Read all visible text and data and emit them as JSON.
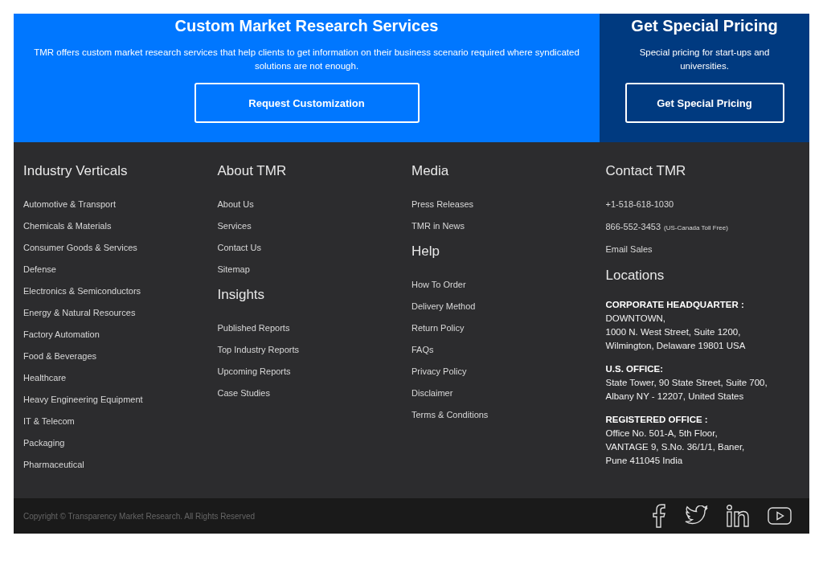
{
  "hero": {
    "custom": {
      "title": "Custom Market Research Services",
      "text": "TMR offers custom market research services that help clients to get information on their business scenario required where syndicated solutions are not enough.",
      "button": "Request Customization"
    },
    "pricing": {
      "title": "Get Special Pricing",
      "text": "Special pricing for start-ups and universities.",
      "button": "Get Special Pricing"
    }
  },
  "footer_columns": [
    {
      "sections": [
        {
          "kind": "links",
          "heading": "Industry Verticals",
          "items": [
            "Automotive & Transport",
            "Chemicals & Materials",
            "Consumer Goods & Services",
            "Defense",
            "Electronics & Semiconductors",
            "Energy & Natural Resources",
            "Factory Automation",
            "Food & Beverages",
            "Healthcare",
            "Heavy Engineering Equipment",
            "IT & Telecom",
            "Packaging",
            "Pharmaceutical"
          ]
        }
      ]
    },
    {
      "sections": [
        {
          "kind": "links",
          "heading": "About TMR",
          "items": [
            "About Us",
            "Services",
            "Contact Us",
            "Sitemap"
          ]
        },
        {
          "kind": "links",
          "heading": "Insights",
          "items": [
            "Published Reports",
            "Top Industry Reports",
            "Upcoming Reports",
            "Case Studies"
          ]
        }
      ]
    },
    {
      "sections": [
        {
          "kind": "links",
          "heading": "Media",
          "items": [
            "Press Releases",
            "TMR in News"
          ]
        },
        {
          "kind": "links",
          "heading": "Help",
          "items": [
            "How To Order",
            "Delivery Method",
            "Return Policy",
            "FAQs",
            "Privacy Policy",
            "Disclaimer",
            "Terms & Conditions"
          ]
        }
      ]
    },
    {
      "sections": [
        {
          "kind": "contacts",
          "heading": "Contact TMR",
          "items": [
            {
              "text": "+1-518-618-1030"
            },
            {
              "text": "866-552-3453",
              "note": "(US-Canada Toll Free)"
            },
            {
              "text": "Email Sales"
            }
          ]
        },
        {
          "kind": "locations",
          "heading": "Locations",
          "items": [
            {
              "title": "CORPORATE HEADQUARTER :",
              "lines": [
                "DOWNTOWN,",
                "1000 N. West Street, Suite 1200,",
                "Wilmington, Delaware 19801 USA"
              ]
            },
            {
              "title": "U.S. OFFICE:",
              "lines": [
                "State Tower, 90 State Street, Suite 700,",
                "Albany NY - 12207, United States"
              ]
            },
            {
              "title": "REGISTERED OFFICE :",
              "lines": [
                "Office No. 501-A, 5th Floor,",
                "VANTAGE 9, S.No. 36/1/1, Baner,",
                "Pune 411045 India"
              ]
            }
          ]
        }
      ]
    }
  ],
  "copyright": "Copyright © Transparency Market Research. All Rights Reserved",
  "social": [
    {
      "kind": "facebook"
    },
    {
      "kind": "twitter"
    },
    {
      "kind": "linkedin"
    },
    {
      "kind": "youtube"
    }
  ]
}
